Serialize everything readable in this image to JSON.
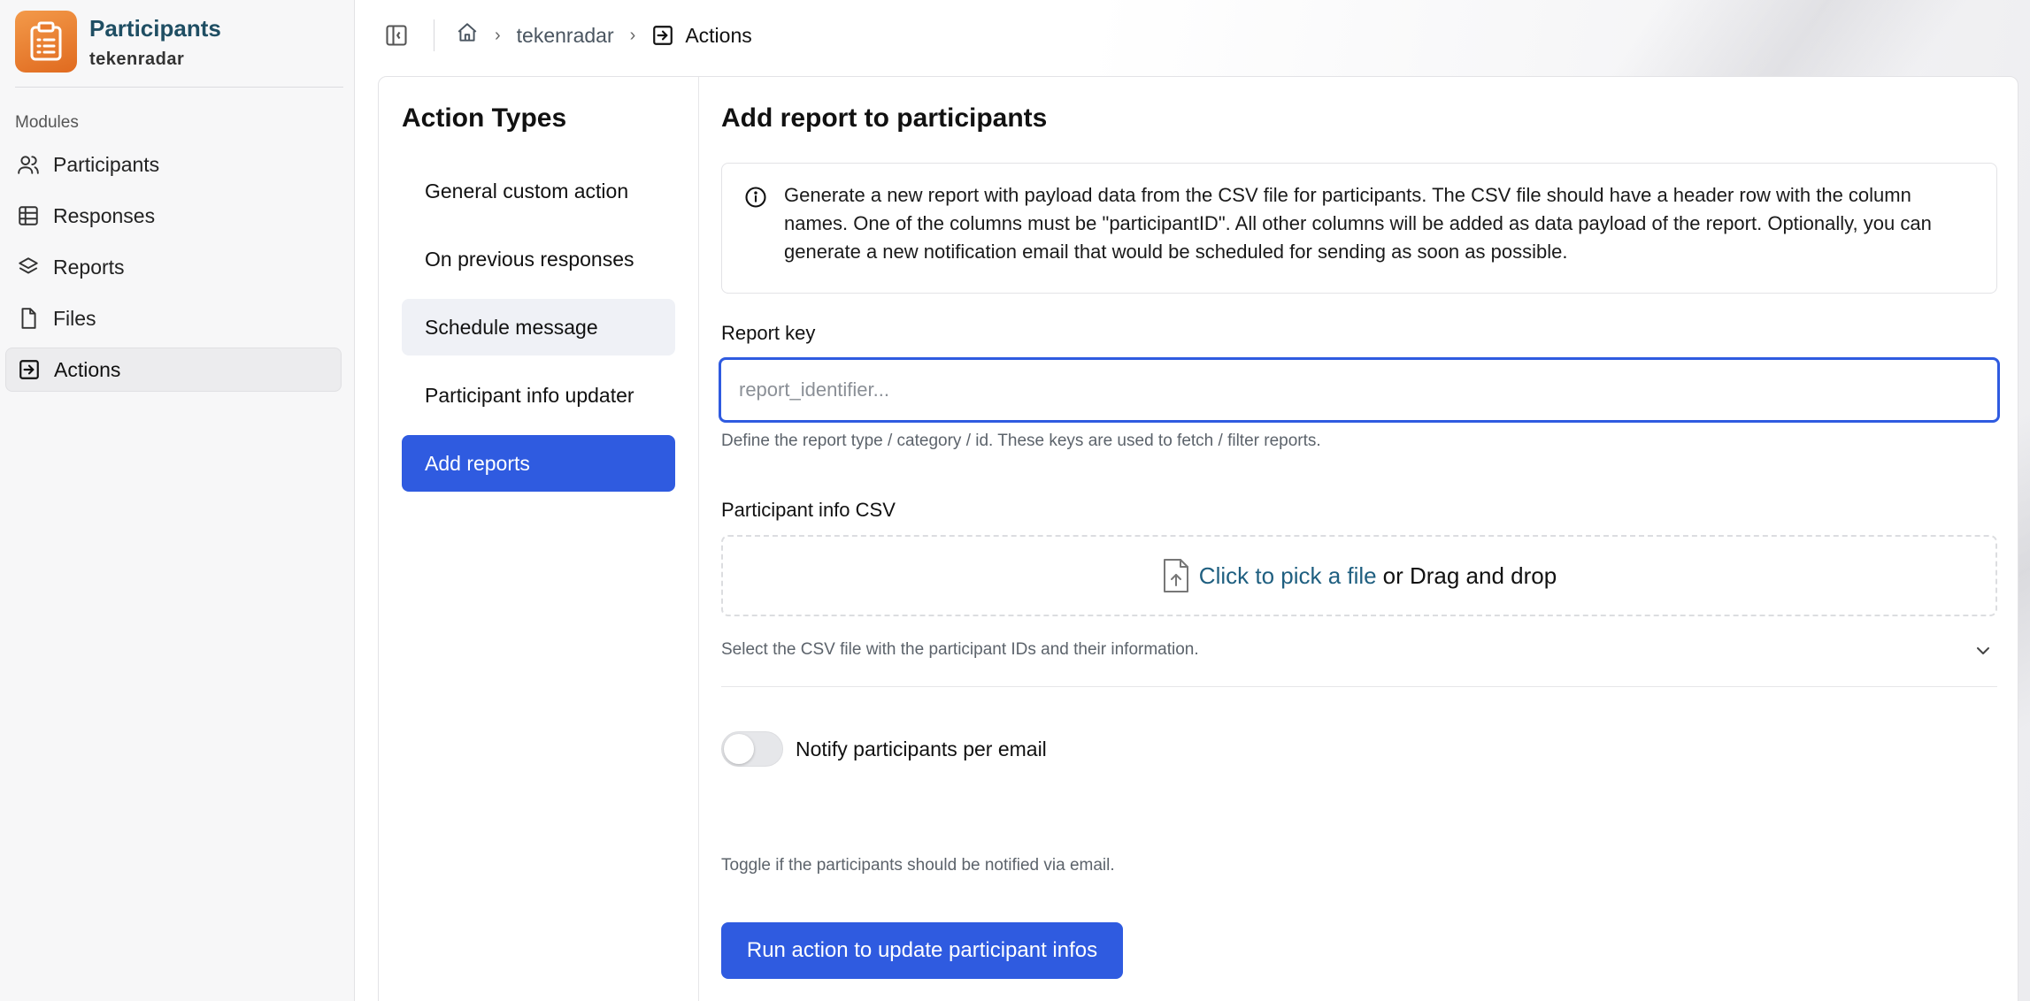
{
  "sidebar": {
    "app_title": "Participants",
    "app_subtitle": "tekenradar",
    "modules_label": "Modules",
    "items": [
      {
        "label": "Participants",
        "icon": "users-icon"
      },
      {
        "label": "Responses",
        "icon": "table-icon"
      },
      {
        "label": "Reports",
        "icon": "layers-icon"
      },
      {
        "label": "Files",
        "icon": "file-icon"
      },
      {
        "label": "Actions",
        "icon": "arrow-box-icon",
        "active": true
      }
    ]
  },
  "breadcrumb": {
    "home_icon": "home-icon",
    "study": "tekenradar",
    "current": "Actions"
  },
  "action_types": {
    "title": "Action Types",
    "items": [
      "General custom action",
      "On previous responses",
      "Schedule message",
      "Participant info updater",
      "Add reports"
    ],
    "selected": "Add reports"
  },
  "form": {
    "title": "Add report to participants",
    "info_text": "Generate a new report with payload data from the CSV file for participants. The CSV file should have a header row with the column names. One of the columns must be \"participantID\". All other columns will be added as data payload of the report. Optionally, you can generate a new notification email that would be scheduled for sending as soon as possible.",
    "report_key_label": "Report key",
    "report_key_placeholder": "report_identifier...",
    "report_key_value": "",
    "report_key_help": "Define the report type / category / id. These keys are used to fetch / filter reports.",
    "csv_label": "Participant info CSV",
    "csv_pick": "Click to pick a file",
    "csv_drag": "or Drag and drop",
    "csv_help": "Select the CSV file with the participant IDs and their information.",
    "notify_label": "Notify participants per email",
    "notify_help": "Toggle if the participants should be notified via email.",
    "notify_on": false,
    "run_button": "Run action to update participant infos"
  },
  "colors": {
    "primary": "#2f5be0",
    "brand_orange": "#e87a2c",
    "brand_title": "#1f4e63"
  }
}
